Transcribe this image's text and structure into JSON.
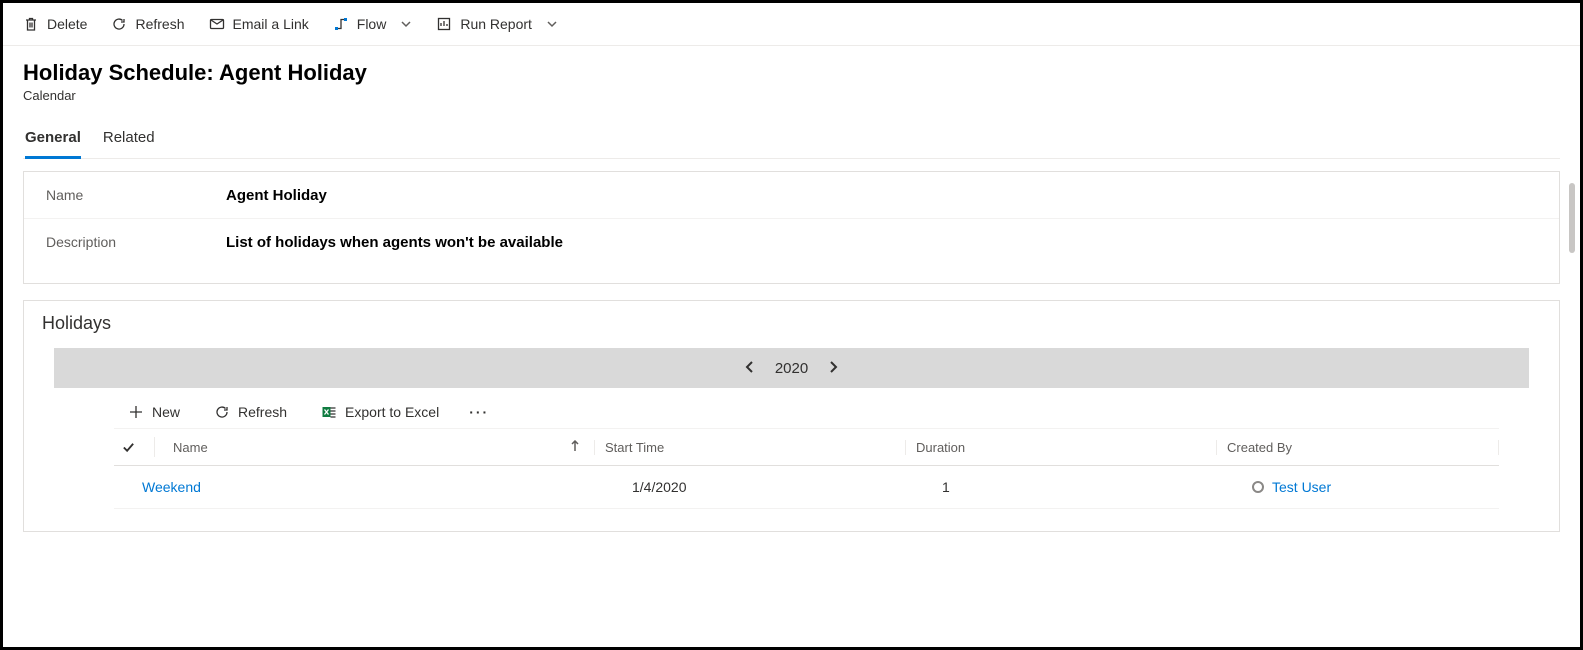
{
  "commandBar": {
    "delete": "Delete",
    "refresh": "Refresh",
    "emailLink": "Email a Link",
    "flow": "Flow",
    "runReport": "Run Report"
  },
  "header": {
    "title": "Holiday Schedule: Agent Holiday",
    "subtitle": "Calendar"
  },
  "tabs": {
    "general": "General",
    "related": "Related"
  },
  "form": {
    "nameLabel": "Name",
    "nameValue": "Agent Holiday",
    "descLabel": "Description",
    "descValue": "List of holidays when agents won't be available"
  },
  "holidays": {
    "sectionTitle": "Holidays",
    "year": "2020",
    "subCmd": {
      "new": "New",
      "refresh": "Refresh",
      "exportExcel": "Export to Excel"
    },
    "columns": {
      "name": "Name",
      "startTime": "Start Time",
      "duration": "Duration",
      "createdBy": "Created By"
    },
    "rows": [
      {
        "name": "Weekend",
        "startTime": "1/4/2020",
        "duration": "1",
        "createdBy": "Test User"
      }
    ]
  }
}
